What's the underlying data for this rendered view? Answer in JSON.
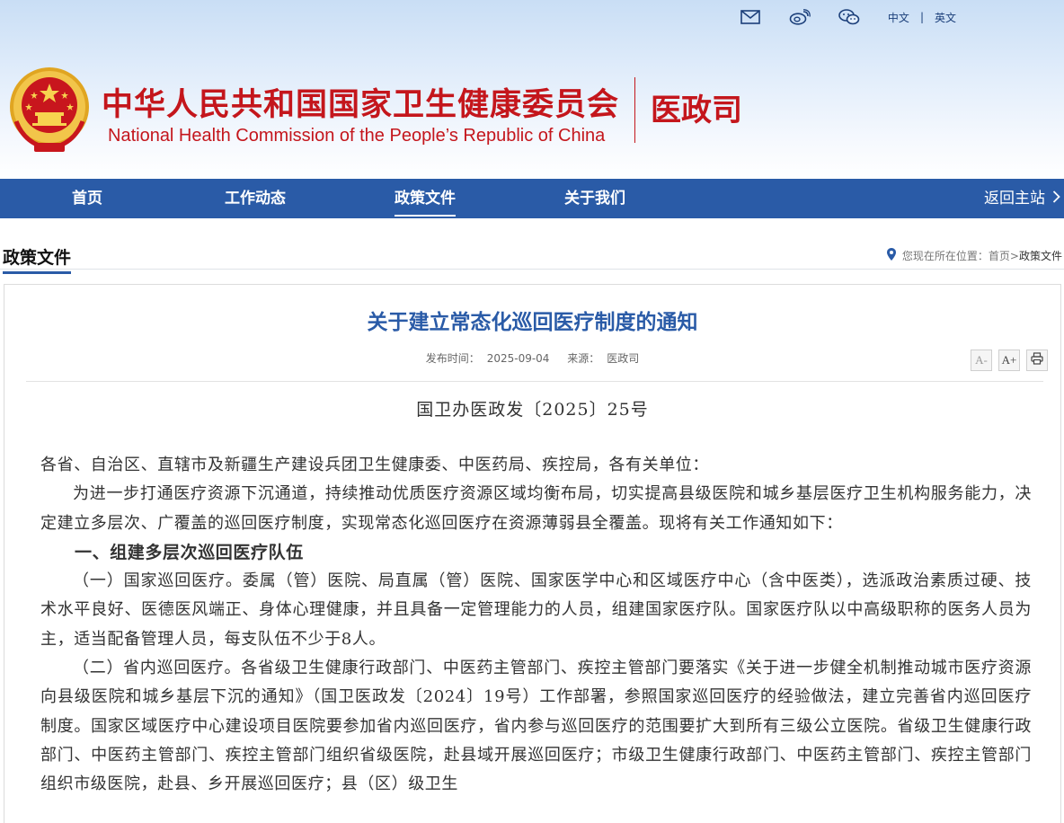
{
  "header": {
    "lang_cn": "中文",
    "lang_sep": "|",
    "lang_en": "英文",
    "site_title_cn": "中华人民共和国国家卫生健康委员会",
    "site_title_en": "National Health Commission of the People’s  Republic of China",
    "dept_name": "医政司",
    "icons": [
      "mail-icon",
      "weibo-icon",
      "wechat-icon"
    ]
  },
  "nav": {
    "items": [
      "首页",
      "工作动态",
      "政策文件",
      "关于我们"
    ],
    "active": "政策文件",
    "back": "返回主站"
  },
  "section": {
    "title": "政策文件",
    "location_label": "您现在所在位置：",
    "crumb_home": "首页",
    "crumb_sep": ">",
    "crumb_current": "政策文件"
  },
  "article": {
    "title": "关于建立常态化巡回医疗制度的通知",
    "meta": {
      "publish_label": "发布时间：",
      "publish_date": "2025-09-04",
      "source_label": "来源：",
      "source": "医政司"
    },
    "tools": {
      "font_smaller": "A-",
      "font_larger": "A+"
    },
    "doc_no": "国卫办医政发〔2025〕25号",
    "salutation": "各省、自治区、直辖市及新疆生产建设兵团卫生健康委、中医药局、疾控局，各有关单位：",
    "intro": "为进一步打通医疗资源下沉通道，持续推动优质医疗资源区域均衡布局，切实提高县级医院和城乡基层医疗卫生机构服务能力，决定建立多层次、广覆盖的巡回医疗制度，实现常态化巡回医疗在资源薄弱县全覆盖。现将有关工作通知如下：",
    "heading1": "一、组建多层次巡回医疗队伍",
    "para1_lead": "（一）国家巡回医疗。",
    "para1": "委属（管）医院、局直属（管）医院、国家医学中心和区域医疗中心（含中医类），选派政治素质过硬、技术水平良好、医德医风端正、身体心理健康，并且具备一定管理能力的人员，组建国家医疗队。国家医疗队以中高级职称的医务人员为主，适当配备管理人员，每支队伍不少于8人。",
    "para2_lead": "（二）省内巡回医疗。",
    "para2": "各省级卫生健康行政部门、中医药主管部门、疾控主管部门要落实《关于进一步健全机制推动城市医疗资源向县级医院和城乡基层下沉的通知》（国卫医政发〔2024〕19号）工作部署，参照国家巡回医疗的经验做法，建立完善省内巡回医疗制度。国家区域医疗中心建设项目医院要参加省内巡回医疗，省内参与巡回医疗的范围要扩大到所有三级公立医院。省级卫生健康行政部门、中医药主管部门、疾控主管部门组织省级医院，赴县域开展巡回医疗；市级卫生健康行政部门、中医药主管部门、疾控主管部门组织市级医院，赴县、乡开展巡回医疗；县（区）级卫生"
  }
}
